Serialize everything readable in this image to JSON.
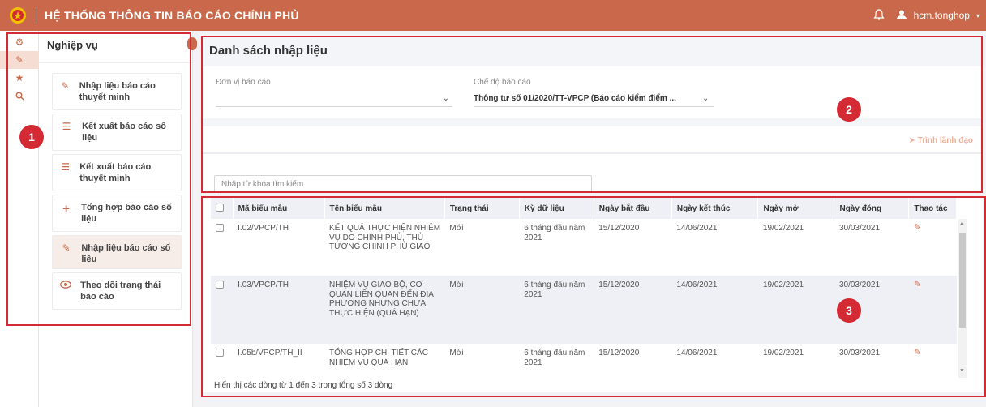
{
  "header": {
    "title": "HỆ THỐNG THÔNG TIN BÁO CÁO CHÍNH PHỦ",
    "username": "hcm.tonghop"
  },
  "colors": {
    "brand": "#c9684a",
    "annotation": "#d42a33"
  },
  "iconbar": [
    "settings-icon",
    "edit-icon",
    "star-icon",
    "search-icon"
  ],
  "sidebar": {
    "title": "Nghiệp vụ",
    "items": [
      {
        "label": "Nhập liệu báo cáo thuyết minh",
        "icon": "pencil-icon"
      },
      {
        "label": "Kết xuất báo cáo số liệu",
        "icon": "list-icon"
      },
      {
        "label": "Kết xuất báo cáo thuyết minh",
        "icon": "list-icon"
      },
      {
        "label": "Tổng hợp báo cáo số liệu",
        "icon": "plus-icon"
      },
      {
        "label": "Nhập liệu báo cáo số liệu",
        "icon": "pencil-icon"
      },
      {
        "label": "Theo dõi trạng thái báo cáo",
        "icon": "eye-icon"
      }
    ]
  },
  "main": {
    "title": "Danh sách nhập liệu",
    "filters": {
      "unit_label": "Đơn vị báo cáo",
      "unit_value": "",
      "mode_label": "Chế độ báo cáo",
      "mode_value": "Thông tư số 01/2020/TT-VPCP (Báo cáo kiểm điểm ..."
    },
    "submit_label": "Trình lãnh đạo",
    "search_placeholder": "Nhập từ khóa tìm kiếm",
    "table": {
      "columns": [
        "Mã biểu mẫu",
        "Tên biểu mẫu",
        "Trạng thái",
        "Kỳ dữ liệu",
        "Ngày bắt đầu",
        "Ngày kết thúc",
        "Ngày mở",
        "Ngày đóng",
        "Thao tác"
      ],
      "rows": [
        {
          "code": "I.02/VPCP/TH",
          "name": "KẾT QUẢ THỰC HIỆN NHIỆM VỤ DO CHÍNH PHỦ, THỦ TƯỚNG CHÍNH PHỦ GIAO",
          "status": "Mới",
          "period": "6 tháng đầu năm 2021",
          "start": "15/12/2020",
          "end": "14/06/2021",
          "open": "19/02/2021",
          "close": "30/03/2021"
        },
        {
          "code": "I.03/VPCP/TH",
          "name": "NHIỆM VỤ GIAO BỘ, CƠ QUAN LIÊN QUAN ĐẾN ĐỊA PHƯƠNG NHƯNG CHƯA THỰC HIỆN (QUÁ HẠN)",
          "status": "Mới",
          "period": "6 tháng đầu năm 2021",
          "start": "15/12/2020",
          "end": "14/06/2021",
          "open": "19/02/2021",
          "close": "30/03/2021"
        },
        {
          "code": "I.05b/VPCP/TH_II",
          "name": "TỔNG HỢP CHI TIẾT CÁC NHIỆM VỤ QUÁ HẠN",
          "status": "Mới",
          "period": "6 tháng đầu năm 2021",
          "start": "15/12/2020",
          "end": "14/06/2021",
          "open": "19/02/2021",
          "close": "30/03/2021"
        }
      ]
    },
    "footer": "Hiển thị các dòng từ 1 đến 3 trong tổng số 3 dòng"
  },
  "annotations": [
    "1",
    "2",
    "3"
  ]
}
